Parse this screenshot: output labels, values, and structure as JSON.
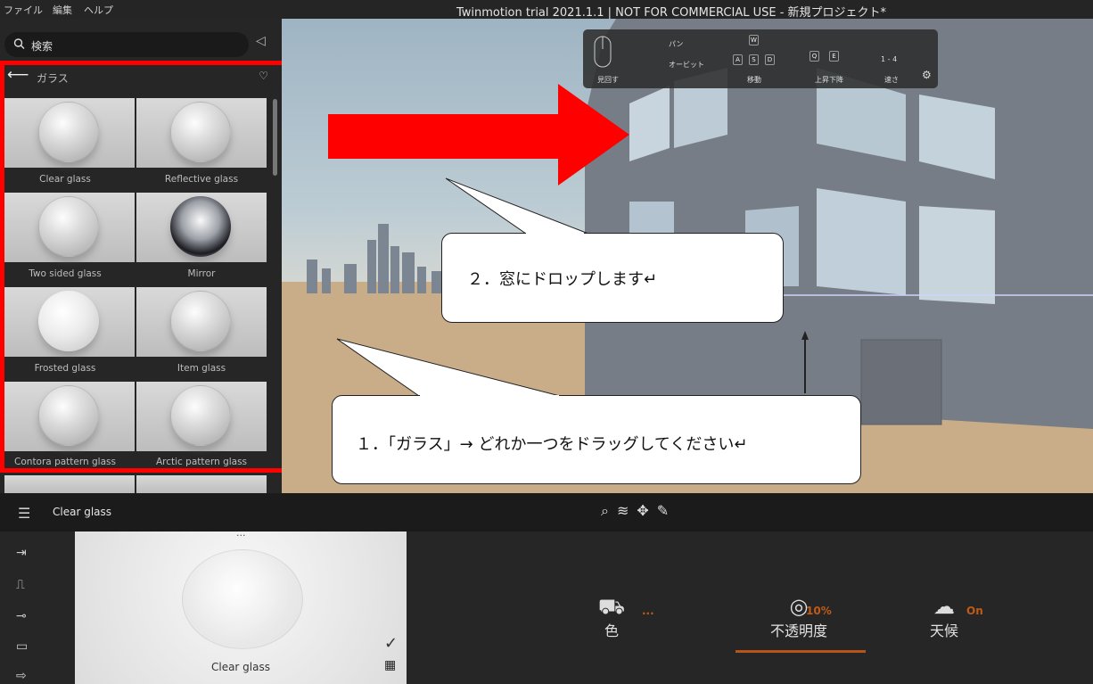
{
  "menubar": {
    "items": [
      "ファイル",
      "編集",
      "ヘルプ"
    ],
    "title": "Twinmotion trial 2021.1.1 | NOT FOR COMMERCIAL USE - 新規プロジェクト*"
  },
  "library": {
    "search_placeholder": "検索",
    "category": "ガラス",
    "materials": [
      "Clear glass",
      "Reflective glass",
      "Two sided glass",
      "Mirror",
      "Frosted glass",
      "Item glass",
      "Contora pattern glass",
      "Arctic pattern glass"
    ]
  },
  "nav_toolbar": {
    "orbit": "見回す",
    "pan": "パン",
    "orbit2": "オービット",
    "move": "移動",
    "updown": "上昇下降",
    "speed": "速さ",
    "speed_value": "1 - 4",
    "keys_move": [
      "W",
      "A",
      "S",
      "D"
    ],
    "keys_updown": [
      "Q",
      "E"
    ]
  },
  "callouts": {
    "step2": "２．窓にドロップします↵",
    "step1": "１．「ガラス」→ どれか一つをドラッグしてください↵"
  },
  "selection": {
    "current": "Clear glass"
  },
  "preview": {
    "name": "Clear glass"
  },
  "properties": {
    "color_label": "色",
    "color_value": "...",
    "opacity_label": "不透明度",
    "opacity_value": "10%",
    "weather_label": "天候",
    "weather_value": "On"
  },
  "colors": {
    "accent": "#b8541a",
    "callout_red": "#ff0000",
    "panel": "#262626"
  },
  "icons": [
    "search-icon",
    "collapse-icon",
    "back-arrow-icon",
    "heart-icon",
    "settings-icon",
    "menu-icon",
    "select-icon",
    "paint-icon",
    "move-icon",
    "eyedropper-icon",
    "import-icon",
    "animate-icon",
    "path-icon",
    "media-icon",
    "export-icon",
    "checkmark-icon",
    "grid-icon",
    "paint-bucket-icon",
    "opacity-icon",
    "weather-icon"
  ]
}
